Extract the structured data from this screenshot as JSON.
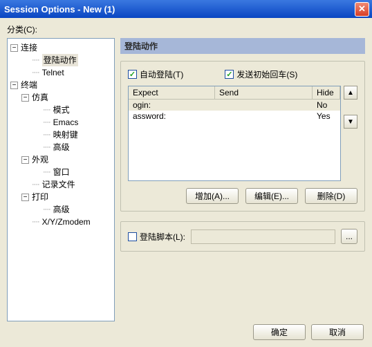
{
  "window": {
    "title": "Session Options - New (1)"
  },
  "category_label": "分类(C):",
  "tree": {
    "n0": "连接",
    "n0_0": "登陆动作",
    "n0_1": "Telnet",
    "n1": "终端",
    "n1_0": "仿真",
    "n1_0_0": "模式",
    "n1_0_1": "Emacs",
    "n1_0_2": "映射键",
    "n1_0_3": "高级",
    "n1_1": "外观",
    "n1_1_0": "窗口",
    "n1_2": "记录文件",
    "n1_3": "打印",
    "n1_3_0": "高级",
    "n1_4": "X/Y/Zmodem"
  },
  "panel": {
    "title": "登陆动作"
  },
  "checks": {
    "auto_logon": "自动登陆(T)",
    "send_cr": "发送初始回车(S)"
  },
  "list": {
    "col_expect": "Expect",
    "col_send": "Send",
    "col_hide": "Hide",
    "rows": [
      {
        "expect": "ogin:",
        "send": "",
        "hide": "No"
      },
      {
        "expect": "assword:",
        "send": "",
        "hide": "Yes"
      }
    ]
  },
  "buttons": {
    "add": "增加(A)...",
    "edit": "编辑(E)...",
    "delete": "删除(D)",
    "ok": "确定",
    "cancel": "取消"
  },
  "script": {
    "label": "登陆脚本(L):",
    "value": ""
  },
  "spin": {
    "up": "▲",
    "down": "▼"
  },
  "browse": "..."
}
